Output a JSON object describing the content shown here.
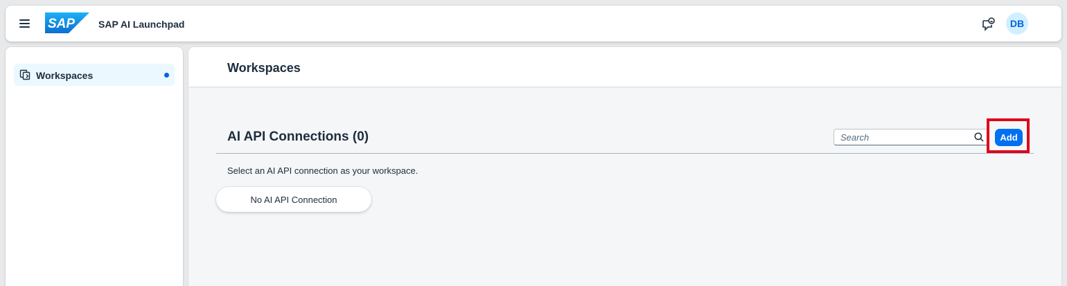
{
  "shellbar": {
    "logo_text": "SAP",
    "app_title": "SAP AI Launchpad",
    "menu_icon": "hamburger-menu-icon",
    "feedback_icon": "feedback-icon",
    "avatar_initials": "DB"
  },
  "sidebar": {
    "items": [
      {
        "label": "Workspaces",
        "icon": "workspaces-icon",
        "selected": true
      }
    ]
  },
  "page": {
    "title": "Workspaces"
  },
  "section": {
    "title": "AI API Connections (0)",
    "search_placeholder": "Search",
    "add_label": "Add",
    "hint": "Select an AI API connection as your workspace.",
    "empty_text": "No AI API Connection"
  },
  "colors": {
    "accent": "#0070f2",
    "highlight": "#e0001a",
    "selected_nav_bg": "#ebf8ff",
    "text": "#1d2d3e"
  }
}
